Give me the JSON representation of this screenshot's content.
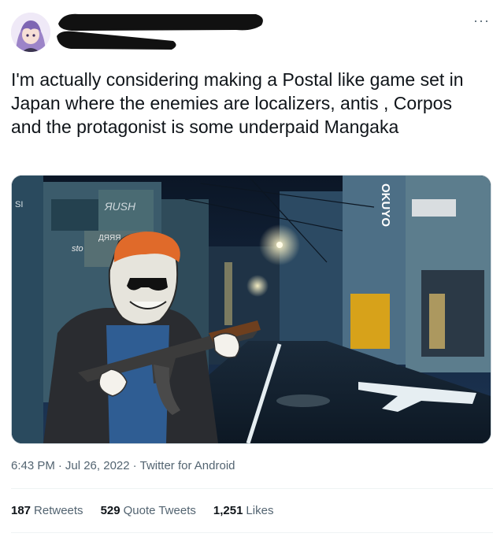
{
  "tweet": {
    "text": "I'm actually considering making a Postal like game set in Japan where the enemies are localizers, antis , Corpos and the protagonist is some underpaid Mangaka",
    "time": "6:43 PM",
    "date": "Jul 26, 2022",
    "source": "Twitter for Android",
    "more_icon": "···"
  },
  "image": {
    "signs": {
      "sign_a": "ЯUSH",
      "sign_b": "ДЯЯЯ",
      "sign_c": "sto",
      "sign_d": "SI",
      "sign_vertical": "OKUYO"
    }
  },
  "stats": {
    "retweets_count": "187",
    "retweets_label": "Retweets",
    "quote_count": "529",
    "quote_label": "Quote Tweets",
    "likes_count": "1,251",
    "likes_label": "Likes"
  },
  "colors": {
    "text_primary": "#0f1419",
    "text_secondary": "#536471",
    "border": "#cfd9de"
  }
}
